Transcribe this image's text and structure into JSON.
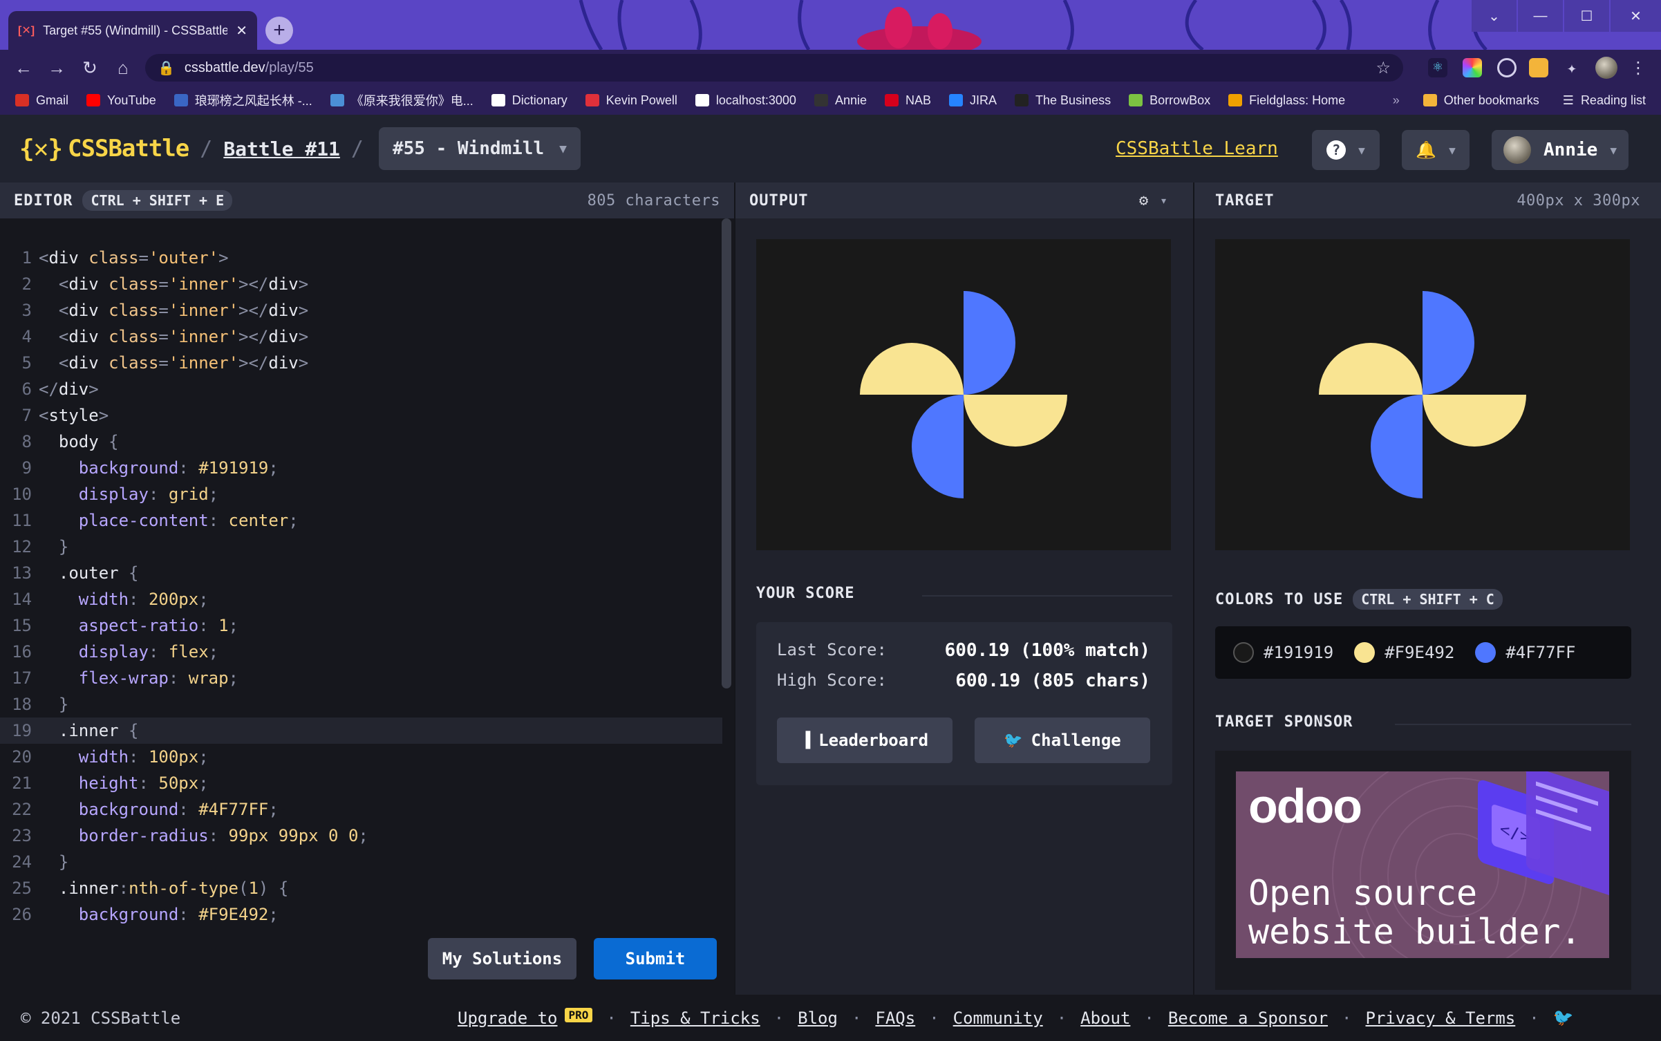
{
  "browser": {
    "tab_title": "Target #55 (Windmill) - CSSBattle",
    "url_host": "cssbattle.dev",
    "url_path": "/play/55",
    "bookmarks": [
      {
        "label": "Gmail",
        "color": "#d93025"
      },
      {
        "label": "YouTube",
        "color": "#ff0000"
      },
      {
        "label": "琅琊榜之风起长林 -...",
        "color": "#3a66c4"
      },
      {
        "label": "《原来我很爱你》电...",
        "color": "#4b8fd6"
      },
      {
        "label": "Dictionary",
        "color": "#ffffff"
      },
      {
        "label": "Kevin Powell",
        "color": "#e0303a"
      },
      {
        "label": "localhost:3000",
        "color": "#ffffff"
      },
      {
        "label": "Annie",
        "color": "#333333"
      },
      {
        "label": "NAB",
        "color": "#d6001c"
      },
      {
        "label": "JIRA",
        "color": "#2684ff"
      },
      {
        "label": "The Business",
        "color": "#222222"
      },
      {
        "label": "BorrowBox",
        "color": "#7cc242"
      },
      {
        "label": "Fieldglass: Home",
        "color": "#f0a000"
      }
    ],
    "more_label": "»",
    "other_bookmarks": "Other bookmarks",
    "reading_list": "Reading list"
  },
  "header": {
    "logo_mark": "{✕}",
    "logo_text": "CSSBattle",
    "battle_label": "Battle #11",
    "target_label": "#55 - Windmill",
    "learn_label": "CSSBattle Learn",
    "help_icon": "?",
    "bell_icon": "🔔",
    "user_name": "Annie"
  },
  "editor": {
    "title": "EDITOR",
    "shortcut": "CTRL + SHIFT + E",
    "char_count": "805 characters",
    "my_solutions": "My Solutions",
    "submit": "Submit"
  },
  "output": {
    "title": "OUTPUT",
    "gear_icon": "⚙",
    "chev_icon": "▾"
  },
  "score": {
    "title": "YOUR SCORE",
    "last_label": "Last Score:",
    "last_value": "600.19 (100% match)",
    "high_label": "High Score:",
    "high_value": "600.19 (805 chars)",
    "leaderboard": "Leaderboard",
    "challenge": "Challenge"
  },
  "target": {
    "title": "TARGET",
    "size": "400px x 300px",
    "colors_title": "COLORS TO USE",
    "colors_shortcut": "CTRL + SHIFT + C",
    "colors": [
      {
        "hex": "#191919"
      },
      {
        "hex": "#F9E492"
      },
      {
        "hex": "#4F77FF"
      }
    ],
    "sponsor_title": "TARGET SPONSOR",
    "sponsor_brand": "odoo",
    "sponsor_tagline_1": "Open source",
    "sponsor_tagline_2": "website builder."
  },
  "footer": {
    "copyright": "© 2021 CSSBattle",
    "upgrade": "Upgrade to",
    "pro": "PRO",
    "tips": "Tips & Tricks",
    "blog": "Blog",
    "faqs": "FAQs",
    "community": "Community",
    "about": "About",
    "sponsor": "Become a Sponsor",
    "privacy": "Privacy & Terms",
    "bullet": "·"
  },
  "code_lines": [
    "<div class='outer'>",
    "  <div class='inner'></div>",
    "  <div class='inner'></div>",
    "  <div class='inner'></div>",
    "  <div class='inner'></div>",
    "</div>",
    "<style>",
    "  body {",
    "    background: #191919;",
    "    display: grid;",
    "    place-content: center;",
    "  }",
    "  .outer {",
    "    width: 200px;",
    "    aspect-ratio: 1;",
    "    display: flex;",
    "    flex-wrap: wrap;",
    "  }",
    "  .inner {",
    "    width: 100px;",
    "    height: 50px;",
    "    background: #4F77FF;",
    "    border-radius: 99px 99px 0 0;",
    "  }",
    "  .inner:nth-of-type(1) {",
    "    background: #F9E492;"
  ]
}
